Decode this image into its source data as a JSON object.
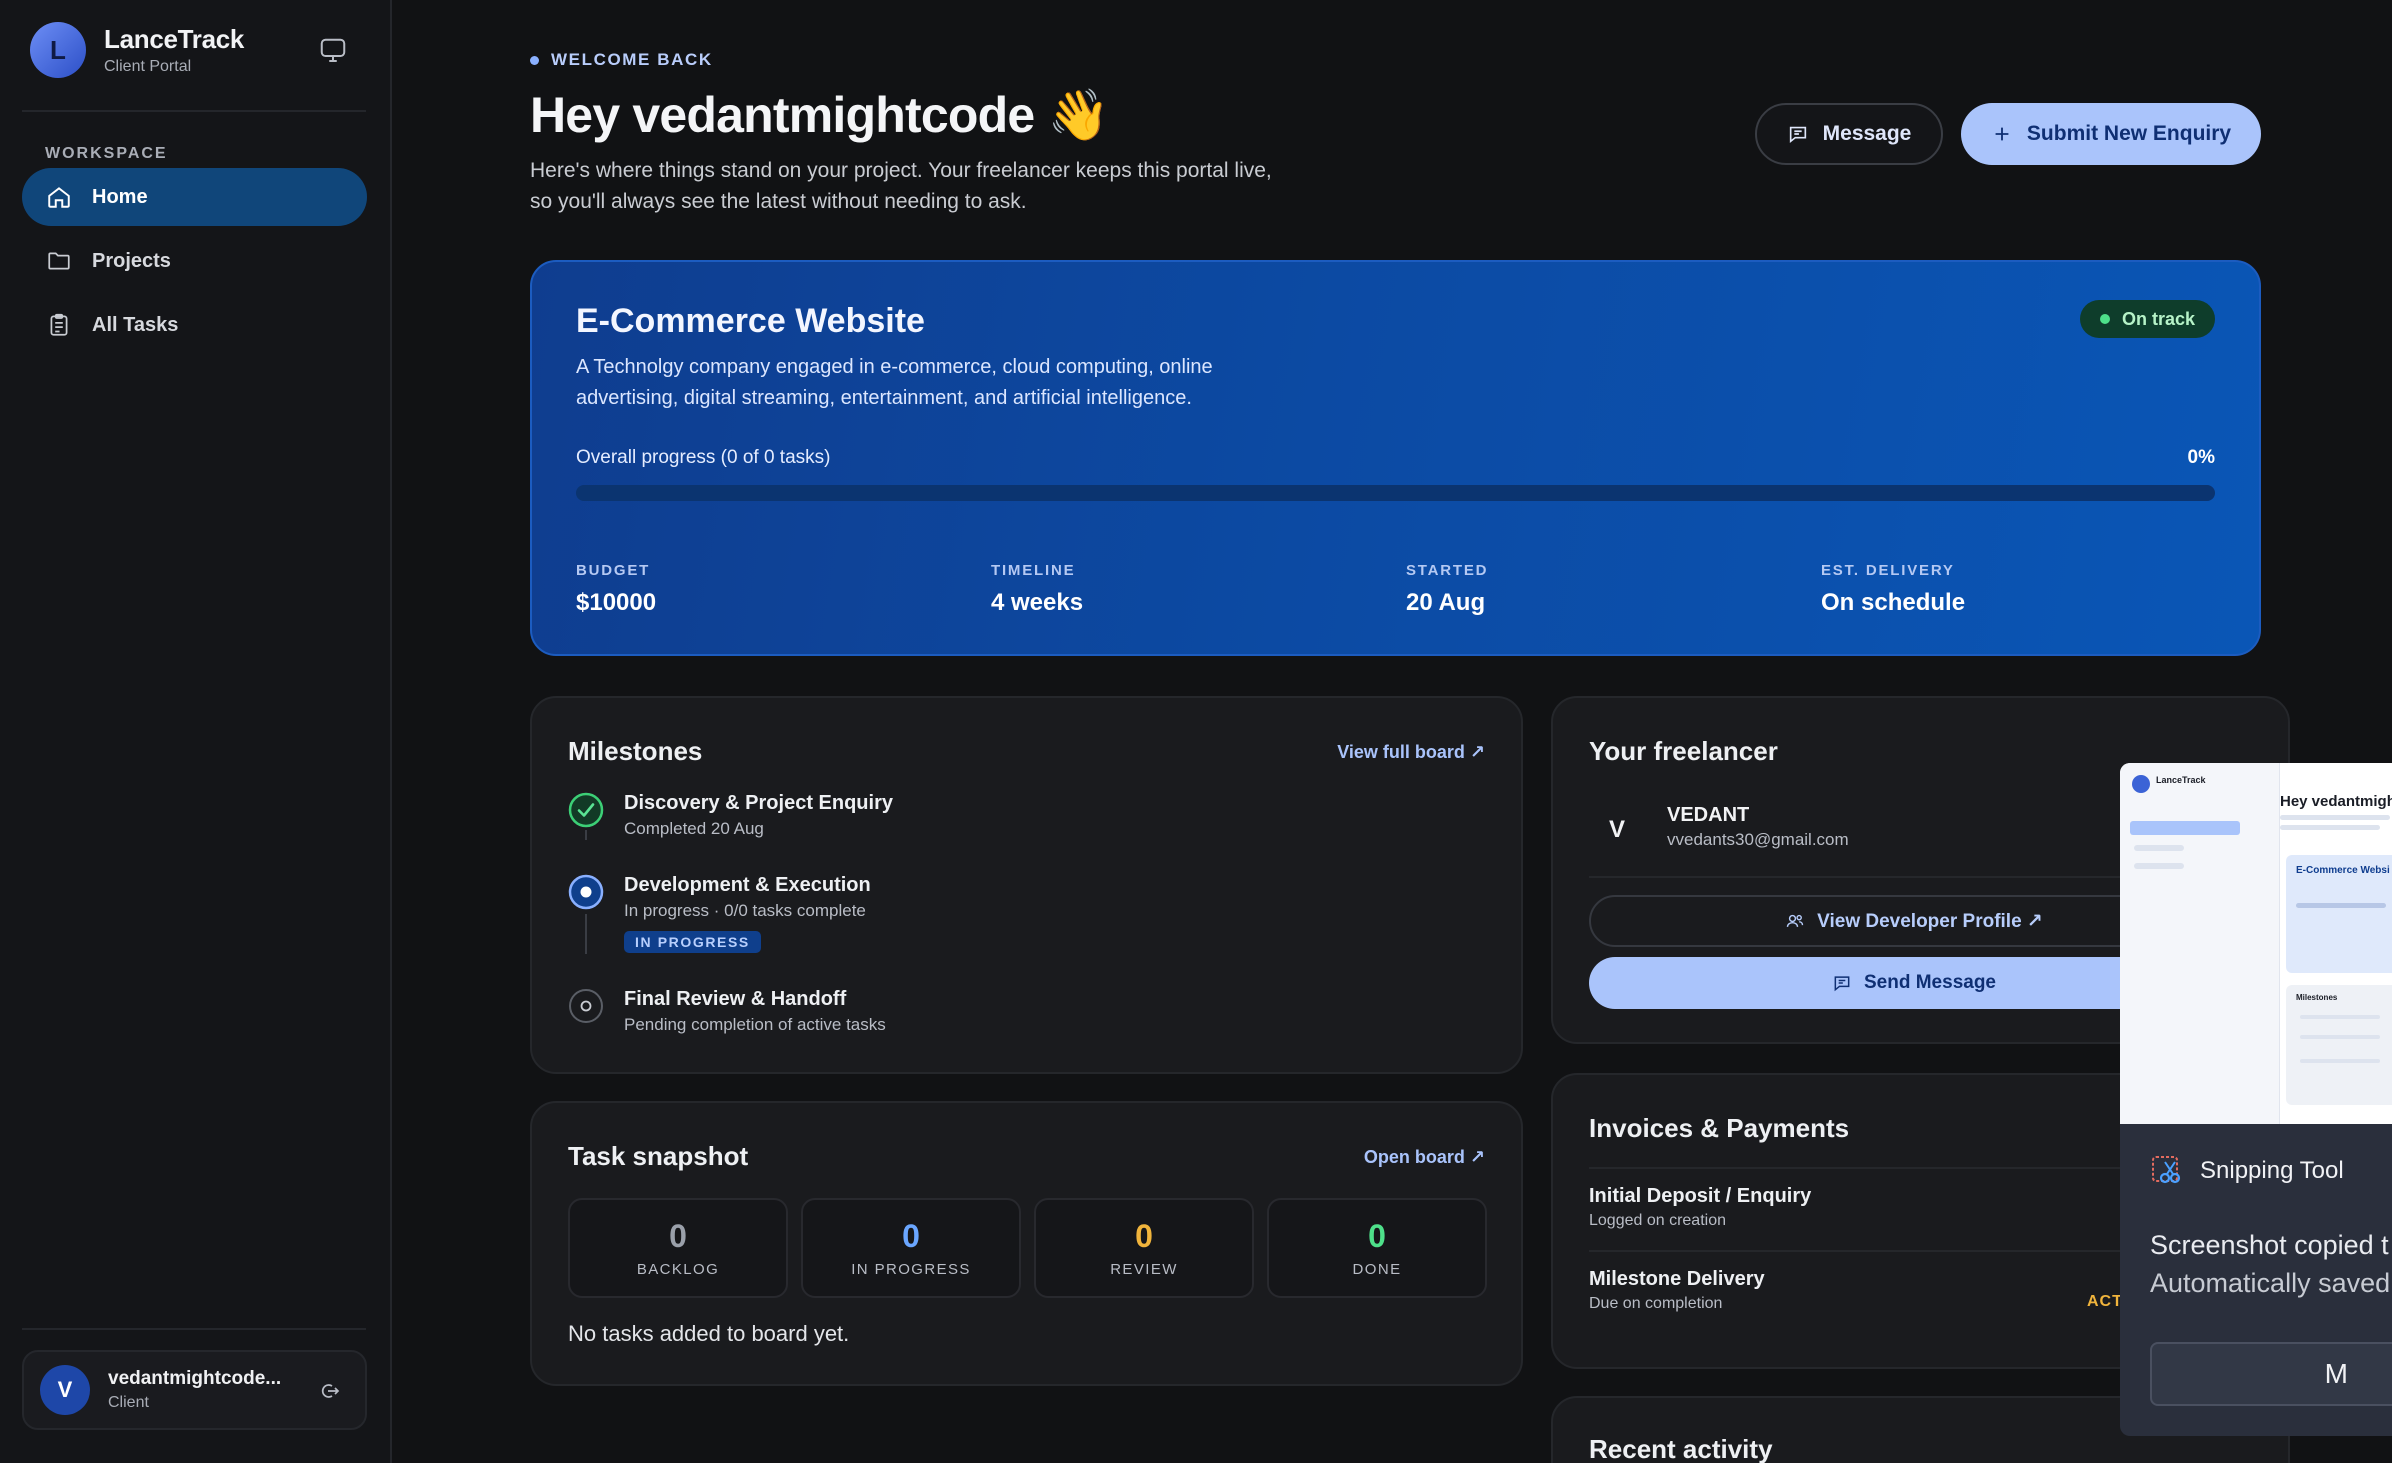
{
  "sidebar": {
    "brand_initial": "L",
    "brand_name": "LanceTrack",
    "brand_sub": "Client Portal",
    "section_label": "WORKSPACE",
    "items": [
      {
        "label": "Home",
        "icon": "home-icon",
        "active": true
      },
      {
        "label": "Projects",
        "icon": "folder-icon",
        "active": false
      },
      {
        "label": "All Tasks",
        "icon": "clipboard-icon",
        "active": false
      }
    ],
    "user": {
      "initial": "V",
      "name": "vedantmightcode...",
      "role": "Client"
    }
  },
  "header": {
    "tag": "WELCOME BACK",
    "greeting": "Hey vedantmightcode 👋",
    "intro_line1": "Here's where things stand on your project. Your freelancer keeps this portal live,",
    "intro_line2": "so you'll always see the latest without needing to ask.",
    "message_button": "Message",
    "submit_button": "Submit New Enquiry"
  },
  "project": {
    "title": "E-Commerce Website",
    "status": "On track",
    "desc_line1": "A Technolgy company engaged in e-commerce, cloud computing, online",
    "desc_line2": "advertising, digital streaming, entertainment, and artificial intelligence.",
    "progress_label": "Overall progress (0 of 0 tasks)",
    "progress_pct_text": "0%",
    "progress_value": 0,
    "stats": [
      {
        "label": "BUDGET",
        "value": "$10000"
      },
      {
        "label": "TIMELINE",
        "value": "4 weeks"
      },
      {
        "label": "STARTED",
        "value": "20 Aug"
      },
      {
        "label": "EST. DELIVERY",
        "value": "On schedule"
      }
    ]
  },
  "milestones": {
    "title": "Milestones",
    "link": "View full board ↗",
    "items": [
      {
        "title": "Discovery & Project Enquiry",
        "sub": "Completed 20 Aug",
        "state": "done"
      },
      {
        "title": "Development & Execution",
        "sub": "In progress · 0/0 tasks complete",
        "state": "active",
        "badge": "IN PROGRESS"
      },
      {
        "title": "Final Review & Handoff",
        "sub": "Pending completion of active tasks",
        "state": "pending"
      }
    ]
  },
  "snapshot": {
    "title": "Task snapshot",
    "link": "Open board ↗",
    "boxes": [
      {
        "count": "0",
        "label": "BACKLOG",
        "color": "#9aa0aa"
      },
      {
        "count": "0",
        "label": "IN PROGRESS",
        "color": "#6aa6ff"
      },
      {
        "count": "0",
        "label": "REVIEW",
        "color": "#f0b43c"
      },
      {
        "count": "0",
        "label": "DONE",
        "color": "#4ee08a"
      }
    ],
    "empty_text": "No tasks added to board yet."
  },
  "freelancer": {
    "title": "Your freelancer",
    "initial": "V",
    "name": "VEDANT",
    "email": "vvedants30@gmail.com",
    "profile_button": "View Developer Profile ↗",
    "send_button": "Send Message"
  },
  "invoices": {
    "title": "Invoices & Payments",
    "items": [
      {
        "title": "Initial Deposit / Enquiry",
        "sub": "Logged on creation"
      },
      {
        "title": "Milestone Delivery",
        "sub": "Due on completion",
        "status": "ACTI"
      }
    ]
  },
  "activity": {
    "title": "Recent activity"
  },
  "snipping_tool": {
    "app_name": "Snipping Tool",
    "line1": "Screenshot copied t",
    "line2": "Automatically saved",
    "button": "M",
    "thumb": {
      "brand": "LanceTrack",
      "greeting": "Hey vedantmigh",
      "project": "E-Commerce Websi",
      "milestones": "Milestones"
    }
  },
  "colors": {
    "accent": "#aac4fb",
    "hero": "#0c4aa3",
    "on_track": "#4ee08a",
    "warning": "#f0b43c"
  }
}
